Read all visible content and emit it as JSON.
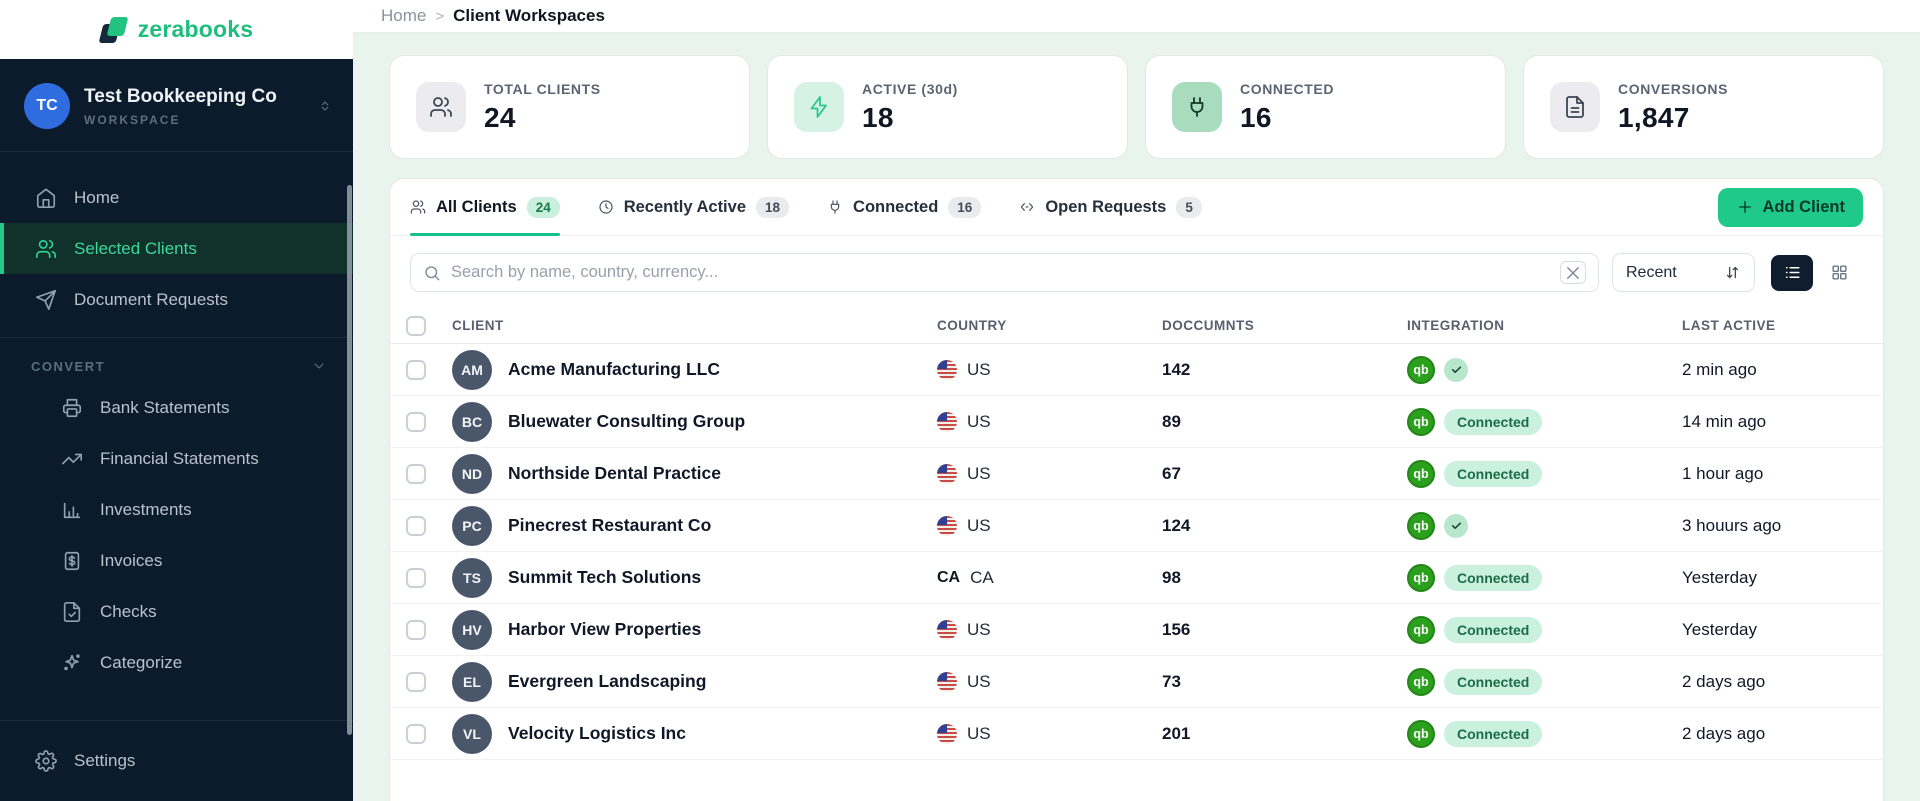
{
  "brand": {
    "name": "zerabooks"
  },
  "workspace": {
    "initials": "TC",
    "name": "Test Bookkeeping Co",
    "label": "WORKSPACE"
  },
  "sidebar": {
    "main_items": [
      {
        "id": "home",
        "label": "Home",
        "icon": "home-icon",
        "active": false
      },
      {
        "id": "selected-clients",
        "label": "Selected Clients",
        "icon": "users-icon",
        "active": true
      },
      {
        "id": "document-requests",
        "label": "Document Requests",
        "icon": "send-icon",
        "active": false
      }
    ],
    "section_label": "CONVERT",
    "convert_items": [
      {
        "id": "bank-statements",
        "label": "Bank Statements",
        "icon": "bank-statements-icon"
      },
      {
        "id": "financial-statements",
        "label": "Financial Statements",
        "icon": "trending-up-icon"
      },
      {
        "id": "investments",
        "label": "Investments",
        "icon": "bar-chart-icon"
      },
      {
        "id": "invoices",
        "label": "Invoices",
        "icon": "invoice-icon"
      },
      {
        "id": "checks",
        "label": "Checks",
        "icon": "file-check-icon"
      },
      {
        "id": "categorize",
        "label": "Categorize",
        "icon": "sparkles-icon"
      }
    ],
    "footer_items": [
      {
        "id": "settings",
        "label": "Settings",
        "icon": "gear-icon"
      }
    ]
  },
  "breadcrumb": {
    "home": "Home",
    "separator": ">",
    "current": "Client Workspaces"
  },
  "stats": [
    {
      "id": "total-clients",
      "label": "TOTAL CLIENTS",
      "value": "24",
      "icon": "users-icon",
      "tone": "gray"
    },
    {
      "id": "active-30d",
      "label": "ACTIVE (30d)",
      "value": "18",
      "icon": "lightning-icon",
      "tone": "mint"
    },
    {
      "id": "connected",
      "label": "CONNECTED",
      "value": "16",
      "icon": "plug-icon",
      "tone": "green"
    },
    {
      "id": "conversions",
      "label": "CONVERSIONS",
      "value": "1,847",
      "icon": "document-icon",
      "tone": "gray"
    }
  ],
  "tabs": [
    {
      "id": "all-clients",
      "label": "All Clients",
      "count": "24",
      "icon": "users-icon",
      "active": true
    },
    {
      "id": "recently-active",
      "label": "Recently Active",
      "count": "18",
      "icon": "clock-icon",
      "active": false
    },
    {
      "id": "connected",
      "label": "Connected",
      "count": "16",
      "icon": "plug-icon",
      "active": false
    },
    {
      "id": "open-requests",
      "label": "Open Requests",
      "count": "5",
      "icon": "open-requests-icon",
      "active": false
    }
  ],
  "toolbar": {
    "add_client_label": "Add Client",
    "search_placeholder": "Search by name, country, currency...",
    "sort_label": "Recent"
  },
  "table": {
    "headers": [
      "CLIENT",
      "COUNTRY",
      "DOCCUMNTS",
      "INTEGRATION",
      "LAST ACTIVE"
    ],
    "qb_label": "qb",
    "connected_label": "Connected",
    "rows": [
      {
        "initials": "AM",
        "name": "Acme Manufacturing LLC",
        "flag": "us",
        "country": "US",
        "documents": "142",
        "integration": "check",
        "last_active": "2 min ago"
      },
      {
        "initials": "BC",
        "name": "Bluewater Consulting Group",
        "flag": "us",
        "country": "US",
        "documents": "89",
        "integration": "connected",
        "last_active": "14 min ago"
      },
      {
        "initials": "ND",
        "name": "Northside Dental Practice",
        "flag": "us",
        "country": "US",
        "documents": "67",
        "integration": "connected",
        "last_active": "1 hour ago"
      },
      {
        "initials": "PC",
        "name": "Pinecrest Restaurant Co",
        "flag": "us",
        "country": "US",
        "documents": "124",
        "integration": "check",
        "last_active": "3 houurs ago"
      },
      {
        "initials": "TS",
        "name": "Summit Tech Solutions",
        "flag": "ca-text",
        "country": "CA",
        "documents": "98",
        "integration": "connected",
        "last_active": "Yesterday"
      },
      {
        "initials": "HV",
        "name": "Harbor View Properties",
        "flag": "us",
        "country": "US",
        "documents": "156",
        "integration": "connected",
        "last_active": "Yesterday"
      },
      {
        "initials": "EL",
        "name": "Evergreen Landscaping",
        "flag": "us",
        "country": "US",
        "documents": "73",
        "integration": "connected",
        "last_active": "2 days ago"
      },
      {
        "initials": "VL",
        "name": "Velocity Logistics Inc",
        "flag": "us",
        "country": "US",
        "documents": "201",
        "integration": "connected",
        "last_active": "2 days ago"
      }
    ]
  },
  "colors": {
    "sidebar_bg": "#0c1b2b",
    "accent_green": "#1ec98a",
    "brand_green": "#1fbd7e",
    "active_nav_text": "#3bd89d",
    "avatar_blue": "#2f6ce0",
    "qb_green": "#2ba01c",
    "mint_bg": "#e9f4ef",
    "pill_bg": "#c9f1de",
    "pill_text": "#1c6c46"
  }
}
